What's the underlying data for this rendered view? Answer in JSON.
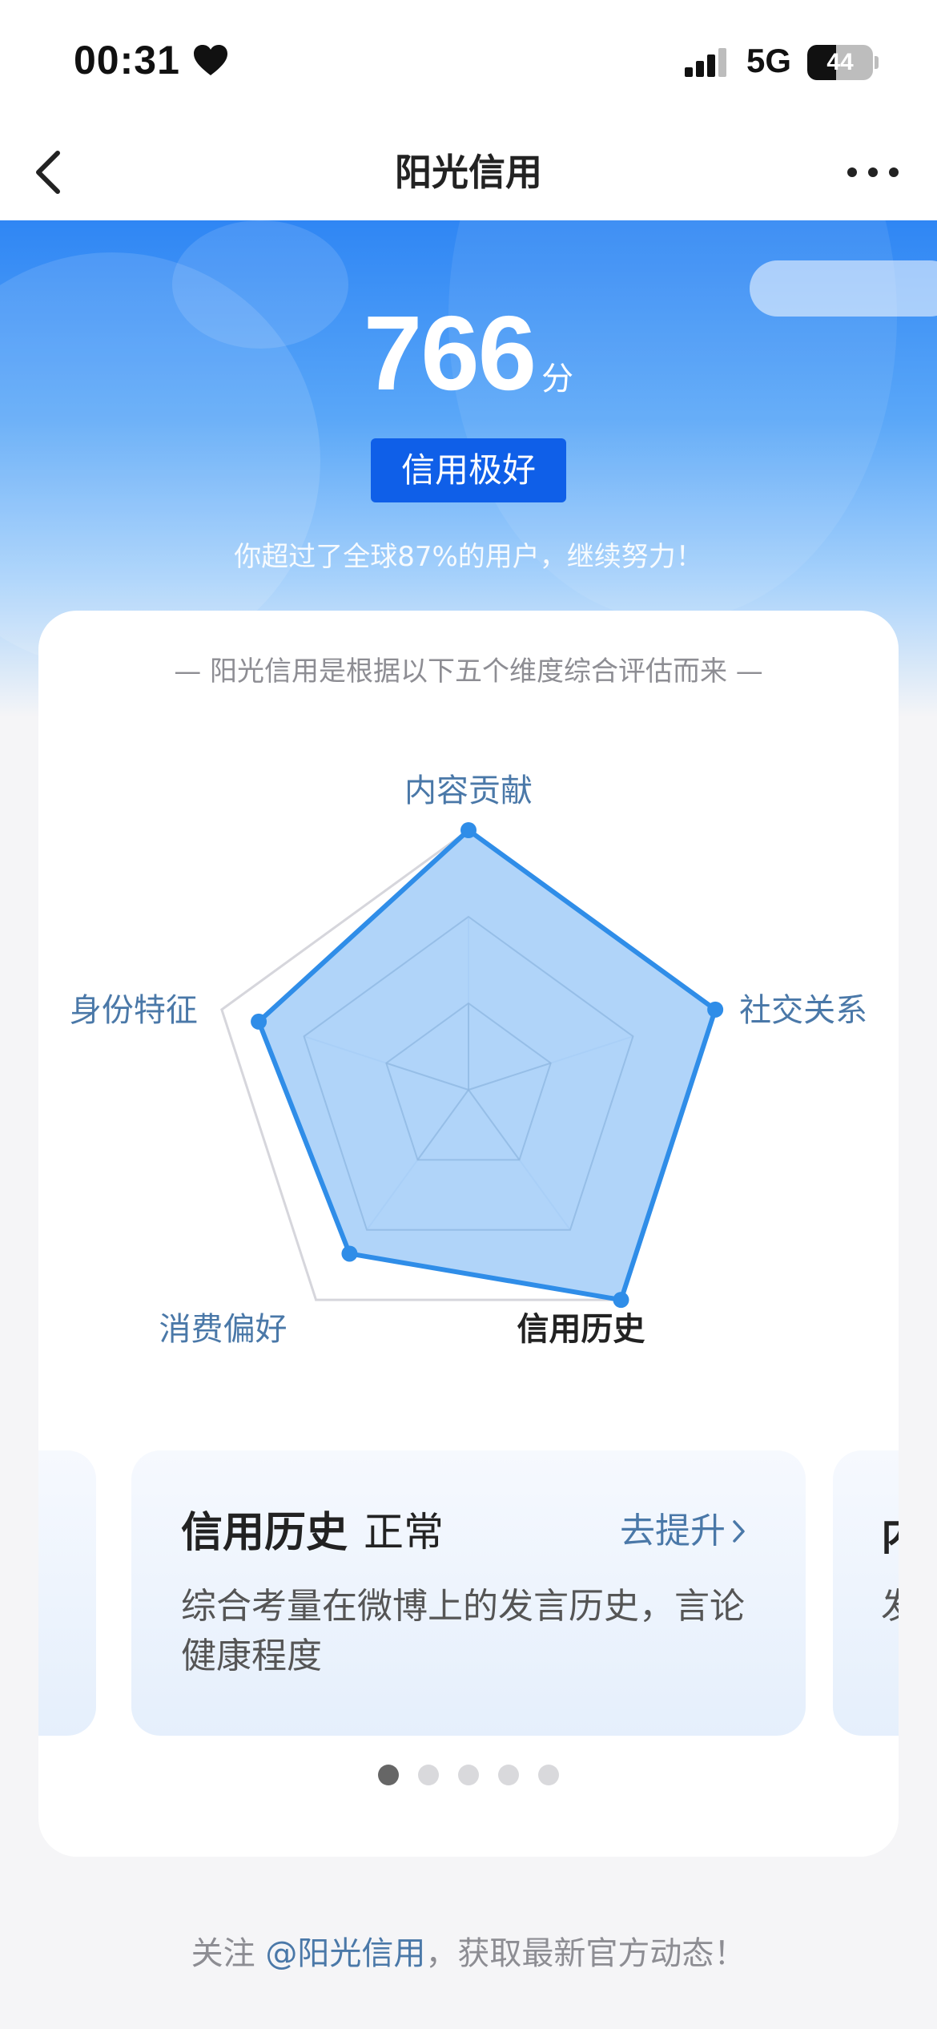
{
  "status_bar": {
    "time": "00:31",
    "network": "5G",
    "battery": "44",
    "battery_level": 0.44
  },
  "nav": {
    "title": "阳光信用"
  },
  "hero": {
    "score": "766",
    "score_unit": "分",
    "badge": "信用极好",
    "rank_text": "你超过了全球87%的用户，继续努力！"
  },
  "card": {
    "caption": "— 阳光信用是根据以下五个维度综合评估而来 —"
  },
  "chart_data": {
    "type": "radar",
    "axes": [
      "内容贡献",
      "社交关系",
      "信用历史",
      "消费偏好",
      "身份特征"
    ],
    "values": [
      1.0,
      1.0,
      1.0,
      0.78,
      0.85
    ],
    "rmax": 1.0,
    "active_axis": "信用历史",
    "colors": {
      "fill": "#a7cff8",
      "stroke": "#2f8de8",
      "grid": "#d6d6dc",
      "spoke": "#b9cde3"
    }
  },
  "carousel": {
    "active": {
      "title": "信用历史",
      "status": "正常",
      "link": "去提升",
      "description": "综合考量在微博上的发言历史，言论健康程度"
    },
    "peek_right": {
      "title": "内",
      "description": "发"
    },
    "dot_count": 5,
    "active_index": 0
  },
  "footer": {
    "prefix": "关注 ",
    "mention": "@阳光信用",
    "suffix": "，获取最新官方动态！"
  }
}
